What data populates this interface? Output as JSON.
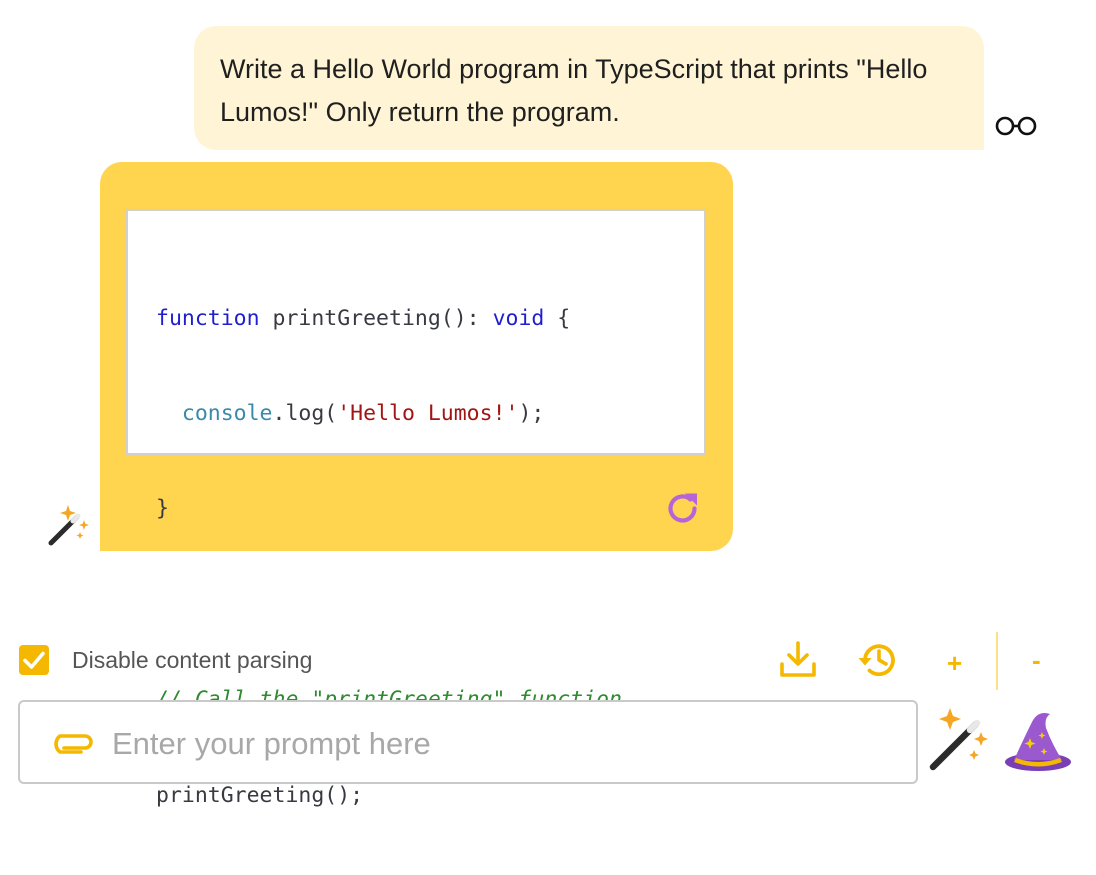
{
  "conversation": {
    "user_message": "Write a Hello World program in TypeScript that prints \"Hello Lumos!\" Only return the program.",
    "user_icon": "glasses-icon",
    "assistant": {
      "code": {
        "line1": {
          "kw": "function",
          "rest": " printGreeting(): ",
          "kw2": "void",
          "end": " {"
        },
        "line2": {
          "indent": "  ",
          "obj": "console",
          "mid": ".log(",
          "str": "'Hello Lumos!'",
          "end": ");"
        },
        "line3": "}",
        "line5": "// Call the \"printGreeting\" function",
        "line6": "printGreeting();"
      },
      "regenerate_icon": "refresh-icon",
      "avatar_icon": "magic-wand-icon"
    }
  },
  "controls": {
    "disable_parsing_checked": true,
    "disable_parsing_label": "Disable content parsing",
    "plus_label": "+",
    "minus_label": "-"
  },
  "prompt": {
    "placeholder": "Enter your prompt here",
    "value": ""
  },
  "colors": {
    "accent": "#f5b800",
    "assistant_bubble": "#ffd54f",
    "user_bubble": "#fff5d6",
    "regenerate": "#b565d8"
  }
}
